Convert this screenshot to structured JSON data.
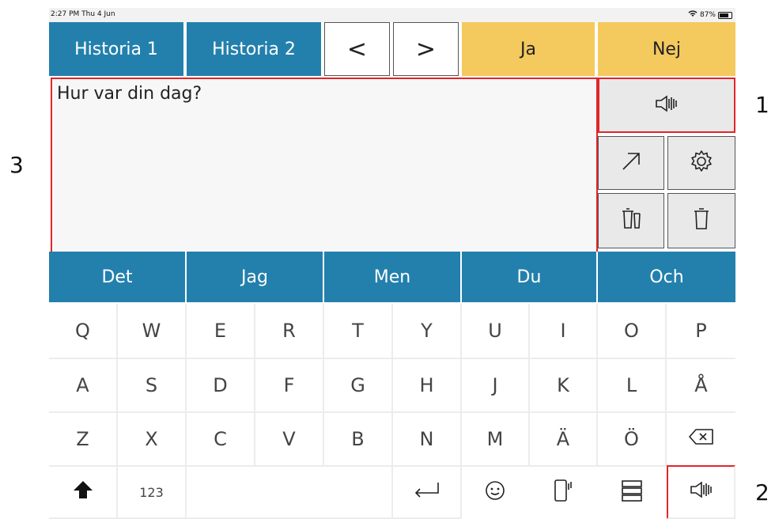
{
  "status": {
    "time": "2:27 PM  Thu 4 Jun",
    "battery": "87%"
  },
  "topbar": {
    "historia1": "Historia 1",
    "historia2": "Historia 2",
    "prev": "<",
    "next": ">",
    "ja": "Ja",
    "nej": "Nej"
  },
  "message": {
    "text": "Hur var din dag?"
  },
  "words": [
    "Det",
    "Jag",
    "Men",
    "Du",
    "Och"
  ],
  "keyboard": {
    "row1": [
      "Q",
      "W",
      "E",
      "R",
      "T",
      "Y",
      "U",
      "I",
      "O",
      "P"
    ],
    "row2": [
      "A",
      "S",
      "D",
      "F",
      "G",
      "H",
      "J",
      "K",
      "L",
      "Å"
    ],
    "row3": [
      "Z",
      "X",
      "C",
      "V",
      "B",
      "N",
      "M",
      "Ä",
      "Ö"
    ],
    "numbers_label": "123"
  },
  "annotations": {
    "a1": "1",
    "a2": "2",
    "a3": "3"
  },
  "colors": {
    "blue": "#2380ad",
    "yellow": "#f4c95d",
    "red": "#e0262a"
  }
}
